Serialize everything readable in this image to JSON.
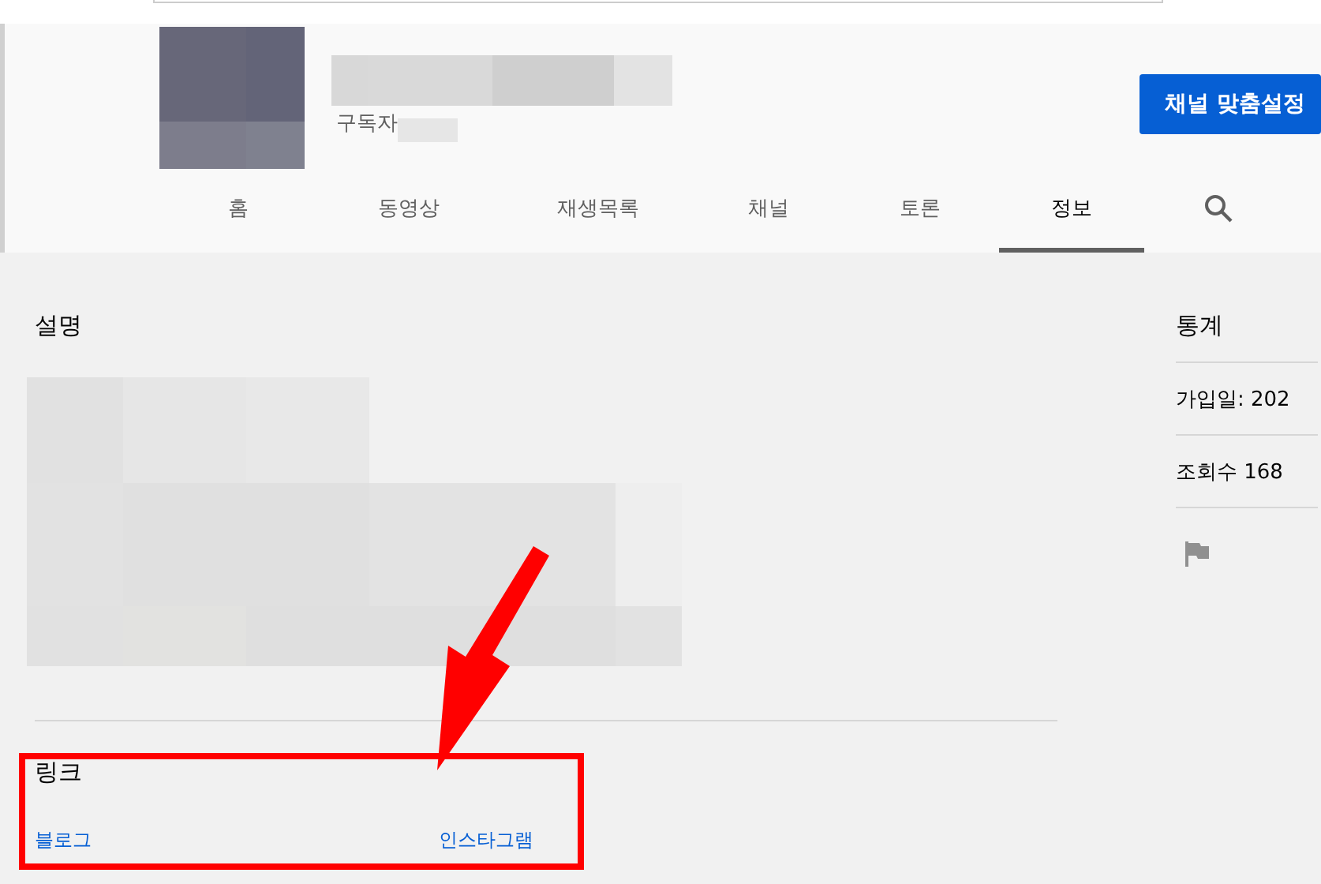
{
  "channel_header": {
    "subscriber_label": "구독자",
    "customize_button": "채널 맞춤설정"
  },
  "tabs": [
    {
      "label": "홈",
      "selected": false
    },
    {
      "label": "동영상",
      "selected": false
    },
    {
      "label": "재생목록",
      "selected": false
    },
    {
      "label": "채널",
      "selected": false
    },
    {
      "label": "토론",
      "selected": false
    },
    {
      "label": "정보",
      "selected": true
    }
  ],
  "description": {
    "heading": "설명"
  },
  "links": {
    "heading": "링크",
    "items": [
      "블로그",
      "인스타그램"
    ]
  },
  "stats": {
    "heading": "통계",
    "items": [
      "가입일: 202",
      "조회수 168"
    ]
  }
}
